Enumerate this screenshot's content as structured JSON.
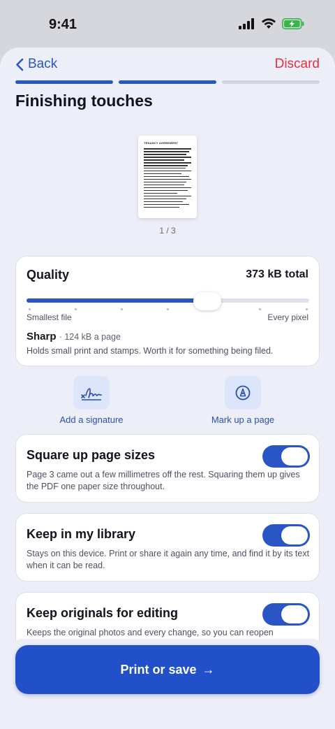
{
  "status": {
    "time": "9:41"
  },
  "nav": {
    "back_label": "Back",
    "discard_label": "Discard"
  },
  "progress": {
    "total_steps": 3,
    "completed_steps": 2
  },
  "page": {
    "title": "Finishing touches"
  },
  "preview": {
    "doc_title": "TENANCY AGREEMENT",
    "page_indicator": "1 / 3"
  },
  "quality": {
    "title": "Quality",
    "total": "373 kB total",
    "min_label": "Smallest file",
    "max_label": "Every pixel",
    "level_fraction": 0.64,
    "stops": 7,
    "level_name": "Sharp",
    "level_sub": "· 124 kB a page",
    "level_desc": "Holds small print and stamps. Worth it for something being filed."
  },
  "tools": [
    {
      "label": "Add a signature",
      "icon": "signature-icon"
    },
    {
      "label": "Mark up a page",
      "icon": "markup-pen-icon"
    }
  ],
  "toggles": [
    {
      "title": "Square up page sizes",
      "desc": "Page 3 came out a few millimetres off the rest. Squaring them up gives the PDF one paper size throughout.",
      "on": true
    },
    {
      "title": "Keep in my library",
      "desc": "Stays on this device. Print or share it again any time, and find it by its text when it can be read.",
      "on": true
    },
    {
      "title": "Keep originals for editing",
      "desc": "Keeps the original photos and every change, so you can reopen",
      "on": true
    }
  ],
  "primary_action": {
    "label": "Print or save",
    "arrow": "→"
  },
  "colors": {
    "accent": "#2a55c4",
    "danger": "#e5313b",
    "sheet_bg": "#eceef8"
  }
}
